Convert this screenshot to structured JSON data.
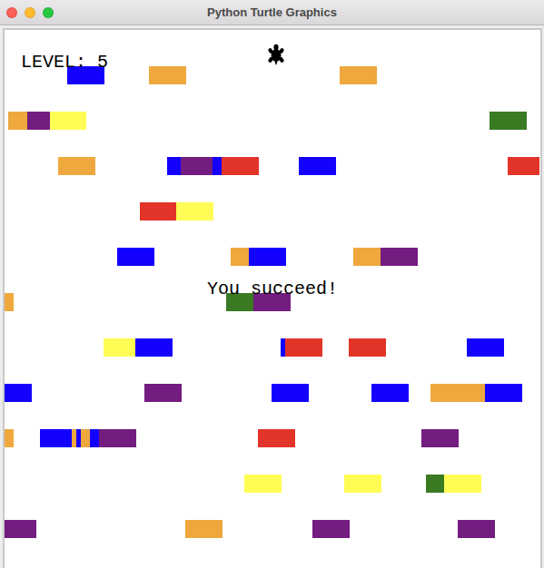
{
  "window": {
    "title": "Python Turtle Graphics"
  },
  "level": {
    "label": "LEVEL: 5"
  },
  "message": "You succeed!",
  "cars": [
    {
      "color": "#1400ff"
    },
    {
      "color": "#eea83e"
    },
    {
      "color": "#eea83e"
    },
    {
      "color": "#eea83e"
    },
    {
      "color": "#741d80"
    },
    {
      "color": "#fffd55"
    },
    {
      "color": "#3a7a23"
    },
    {
      "color": "#eea83e"
    },
    {
      "color": "#1400ff"
    },
    {
      "color": "#741d80"
    },
    {
      "color": "#1400ff"
    },
    {
      "color": "#e3342a"
    },
    {
      "color": "#1400ff"
    },
    {
      "color": "#e3342a"
    },
    {
      "color": "#e3342a"
    },
    {
      "color": "#fffd55"
    },
    {
      "color": "#1400ff"
    },
    {
      "color": "#eea83e"
    },
    {
      "color": "#1400ff"
    },
    {
      "color": "#eea83e"
    },
    {
      "color": "#741d80"
    },
    {
      "color": "#eea83e"
    },
    {
      "color": "#3a7a23"
    },
    {
      "color": "#741d80"
    },
    {
      "color": "#fffd55"
    },
    {
      "color": "#1400ff"
    },
    {
      "color": "#1400ff"
    },
    {
      "color": "#e3342a"
    },
    {
      "color": "#e3342a"
    },
    {
      "color": "#1400ff"
    },
    {
      "color": "#1400ff"
    },
    {
      "color": "#741d80"
    },
    {
      "color": "#1400ff"
    },
    {
      "color": "#1400ff"
    },
    {
      "color": "#eea83e"
    },
    {
      "color": "#1400ff"
    },
    {
      "color": "#eea83e"
    },
    {
      "color": "#1400ff"
    },
    {
      "color": "#eea83e"
    },
    {
      "color": "#1400ff"
    },
    {
      "color": "#eea83e"
    },
    {
      "color": "#1400ff"
    },
    {
      "color": "#741d80"
    },
    {
      "color": "#e3342a"
    },
    {
      "color": "#741d80"
    },
    {
      "color": "#fffd55"
    },
    {
      "color": "#fffd55"
    },
    {
      "color": "#3a7a23"
    },
    {
      "color": "#fffd55"
    },
    {
      "color": "#741d80"
    },
    {
      "color": "#eea83e"
    },
    {
      "color": "#741d80"
    },
    {
      "color": "#741d80"
    }
  ]
}
